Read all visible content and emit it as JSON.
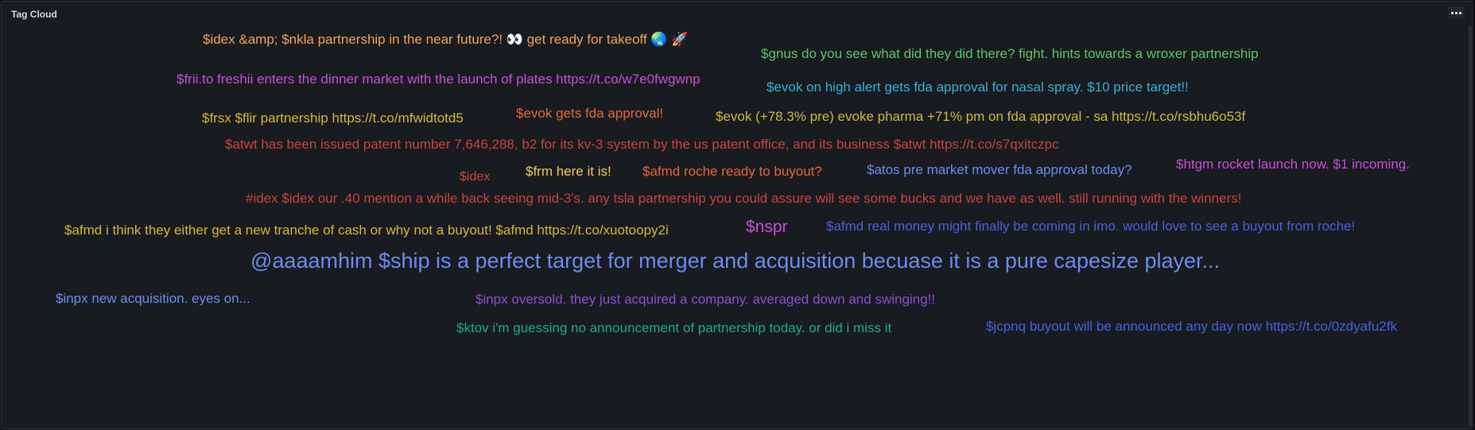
{
  "panel": {
    "title": "Tag Cloud"
  },
  "icons": {
    "menu": "ellipsis-icon"
  },
  "tags": [
    {
      "text": "$idex &amp; $nkla partnership in the near future?! 👀 get ready for takeoff 🌏 🚀",
      "color": "#f0a35a"
    },
    {
      "text": "$gnus do you see what did they did there? fight. hints towards a wroxer partnership",
      "color": "#5ec46a"
    },
    {
      "text": "$frii.to freshii enters the dinner market with the launch of plates https://t.co/w7e0fwgwnp",
      "color": "#c84fd8"
    },
    {
      "text": "$evok on high alert gets fda approval for nasal spray. $10 price target!!",
      "color": "#3aaed8"
    },
    {
      "text": "$frsx $flir partnership https://t.co/mfwidtotd5",
      "color": "#d4b83a"
    },
    {
      "text": "$evok gets fda approval!",
      "color": "#e8663a"
    },
    {
      "text": "$evok (+78.3% pre) evoke pharma +71% pm on fda approval - sa https://t.co/rsbhu6o53f",
      "color": "#d4b83a"
    },
    {
      "text": "$atwt has been issued patent number 7,646,288, b2 for its kv-3 system by the us patent office, and its business $atwt https://t.co/s7qxitczpc",
      "color": "#c9433f"
    },
    {
      "text": "$idex",
      "color": "#c9433f"
    },
    {
      "text": "$frm here it is!",
      "color": "#f2cc5c"
    },
    {
      "text": "$afmd roche ready to buyout?",
      "color": "#e8663a"
    },
    {
      "text": "$atos pre market mover fda approval today?",
      "color": "#6b8cf0"
    },
    {
      "text": "$htgm rocket launch now. $1 incoming.",
      "color": "#c84fd8"
    },
    {
      "text": "#idex $idex our .40 mention a while back seeing mid-3's. any tsla partnership you could assure will see some bucks and we have as well. still running with the winners!",
      "color": "#c9433f"
    },
    {
      "text": "$afmd i think they either get a new tranche of cash or why not a buyout! $afmd https://t.co/xuotoopy2i",
      "color": "#d4b83a"
    },
    {
      "text": "$nspr",
      "color": "#c84fd8"
    },
    {
      "text": "$afmd real money might finally be coming in imo. would love to see a buyout from roche!",
      "color": "#4a5fe0"
    },
    {
      "text": "@aaaamhim $ship is a perfect target for merger and acquisition becuase it is a pure capesize player...",
      "color": "#6b8cf0"
    },
    {
      "text": "$inpx new acquisition. eyes on...",
      "color": "#6b8cf0"
    },
    {
      "text": "$inpx oversold. they just acquired a company. averaged down and swinging!!",
      "color": "#8a4fd8"
    },
    {
      "text": "$ktov i'm guessing no announcement of partnership today. or did i miss it",
      "color": "#1fa98a"
    },
    {
      "text": "$jcpnq buyout will be announced any day now https://t.co/0zdyafu2fk",
      "color": "#4a5fe0"
    }
  ]
}
